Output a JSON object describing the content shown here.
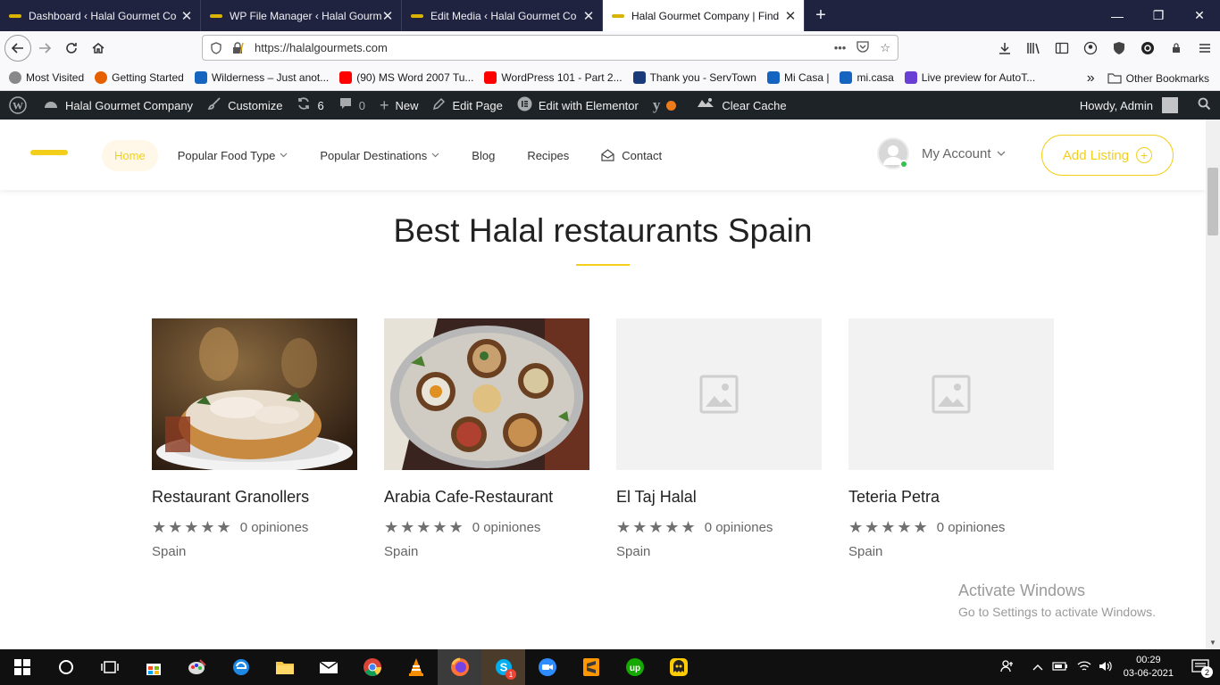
{
  "browser": {
    "tabs": [
      {
        "title": "Dashboard ‹ Halal Gourmet Co",
        "active": false
      },
      {
        "title": "WP File Manager ‹ Halal Gourm",
        "active": false
      },
      {
        "title": "Edit Media ‹ Halal Gourmet Co",
        "active": false
      },
      {
        "title": "Halal Gourmet Company | Find",
        "active": true
      }
    ],
    "new_tab": "+",
    "url": "https://halalgourmets.com",
    "window_controls": {
      "minimize": "—",
      "restore": "❐",
      "close": "✕"
    }
  },
  "bookmarks": {
    "items": [
      {
        "label": "Most Visited",
        "color": "#ff9500"
      },
      {
        "label": "Getting Started",
        "color": "#e66000"
      },
      {
        "label": "Wilderness – Just anot...",
        "color": "#1565c0"
      },
      {
        "label": "(90) MS Word 2007 Tu...",
        "color": "#ff0000"
      },
      {
        "label": "WordPress 101 - Part 2...",
        "color": "#ff0000"
      },
      {
        "label": "Thank you - ServTown",
        "color": "#1a3a7a"
      },
      {
        "label": "Mi Casa |",
        "color": "#1565c0"
      },
      {
        "label": "mi.casa",
        "color": "#1565c0"
      },
      {
        "label": "Live preview for AutoT...",
        "color": "#6a3fd4"
      }
    ],
    "more": "»",
    "other": "Other Bookmarks"
  },
  "wp_admin_bar": {
    "site_name": "Halal Gourmet Company",
    "customize": "Customize",
    "updates_count": "6",
    "comments_count": "0",
    "new": "New",
    "edit_page": "Edit Page",
    "edit_elementor": "Edit with Elementor",
    "clear_cache": "Clear Cache",
    "howdy": "Howdy, Admin"
  },
  "site_header": {
    "menu": [
      {
        "label": "Home",
        "dropdown": false
      },
      {
        "label": "Popular Food Type",
        "dropdown": true
      },
      {
        "label": "Popular Destinations",
        "dropdown": true
      },
      {
        "label": "Blog",
        "dropdown": false
      },
      {
        "label": "Recipes",
        "dropdown": false
      },
      {
        "label": "Contact",
        "dropdown": false
      }
    ],
    "account_label": "My Account",
    "add_listing": "Add Listing",
    "accent_color": "#f3cf1b"
  },
  "main": {
    "heading": "Best Halal restaurants Spain",
    "listings": [
      {
        "name": "Restaurant Granollers",
        "stars": 5,
        "reviews": "0 opiniones",
        "location": "Spain",
        "image": "photo-tagine"
      },
      {
        "name": "Arabia Cafe-Restaurant",
        "stars": 5,
        "reviews": "0 opiniones",
        "location": "Spain",
        "image": "photo-platter"
      },
      {
        "name": "El Taj Halal",
        "stars": 5,
        "reviews": "0 opiniones",
        "location": "Spain",
        "image": "placeholder"
      },
      {
        "name": "Teteria Petra",
        "stars": 5,
        "reviews": "0 opiniones",
        "location": "Spain",
        "image": "placeholder"
      }
    ]
  },
  "watermark": {
    "line1": "Activate Windows",
    "line2": "Go to Settings to activate Windows."
  },
  "taskbar": {
    "time": "00:29",
    "date": "03-06-2021",
    "notification_count": "2",
    "skype_badge": "1"
  }
}
